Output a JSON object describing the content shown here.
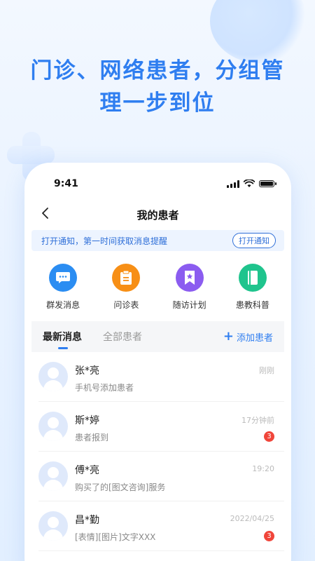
{
  "headline": {
    "line1": "门诊、网络患者，分组管",
    "line2": "理一步到位"
  },
  "status_bar": {
    "time": "9:41"
  },
  "nav": {
    "title": "我的患者"
  },
  "notice": {
    "text": "打开通知，第一时间获取消息提醒",
    "button": "打开通知"
  },
  "shortcuts": [
    {
      "label": "群发消息",
      "icon": "chat-bubble-icon",
      "color": "#2b8df2"
    },
    {
      "label": "问诊表",
      "icon": "clipboard-icon",
      "color": "#f78f16"
    },
    {
      "label": "随访计划",
      "icon": "bookmark-star-icon",
      "color": "#8b5cf0"
    },
    {
      "label": "患教科普",
      "icon": "book-icon",
      "color": "#1fc48d"
    }
  ],
  "tabs": [
    {
      "label": "最新消息",
      "active": true
    },
    {
      "label": "全部患者",
      "active": false
    }
  ],
  "add_patient": "添加患者",
  "patients": [
    {
      "name": "张*亮",
      "message": "手机号添加患者",
      "time": "刚刚",
      "badge": ""
    },
    {
      "name": "斯*婷",
      "message": "患者报到",
      "time": "17分钟前",
      "badge": "3"
    },
    {
      "name": "傅*亮",
      "message": "购买了的[图文咨询]服务",
      "time": "19:20",
      "badge": ""
    },
    {
      "name": "昌*勤",
      "message": "[表情][图片]文字XXX",
      "time": "2022/04/25",
      "badge": "3"
    }
  ],
  "colors": {
    "accent": "#2f7ef0",
    "badge": "#f0453a"
  }
}
